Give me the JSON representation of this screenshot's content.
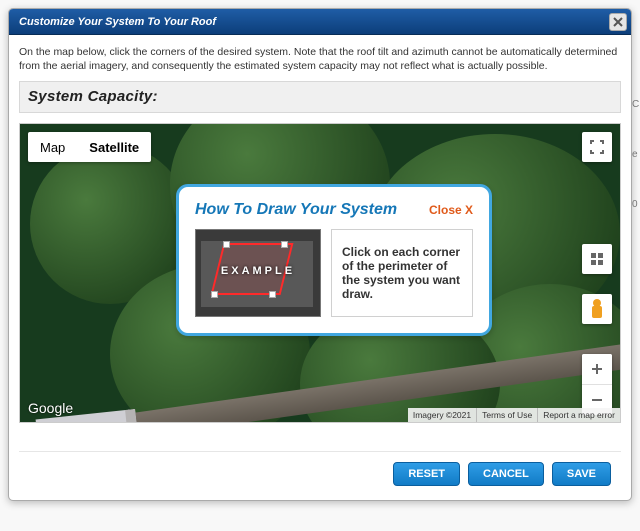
{
  "dialog": {
    "title": "Customize Your System To Your Roof",
    "instruction": "On the map below, click the corners of the desired system. Note that the roof tilt and azimuth cannot be automatically determined from the aerial imagery, and consequently the estimated system capacity may not reflect what is actually possible.",
    "capacity_label": "System Capacity:"
  },
  "map": {
    "type_map": "Map",
    "type_satellite": "Satellite",
    "google": "Google",
    "imagery": "Imagery ©2021",
    "terms": "Terms of Use",
    "report": "Report a map error"
  },
  "howto": {
    "title": "How To Draw Your System",
    "close": "Close X",
    "example": "EXAMPLE",
    "text": "Click on each corner of the perimeter of the system you want draw."
  },
  "buttons": {
    "reset": "RESET",
    "cancel": "CANCEL",
    "save": "SAVE"
  }
}
